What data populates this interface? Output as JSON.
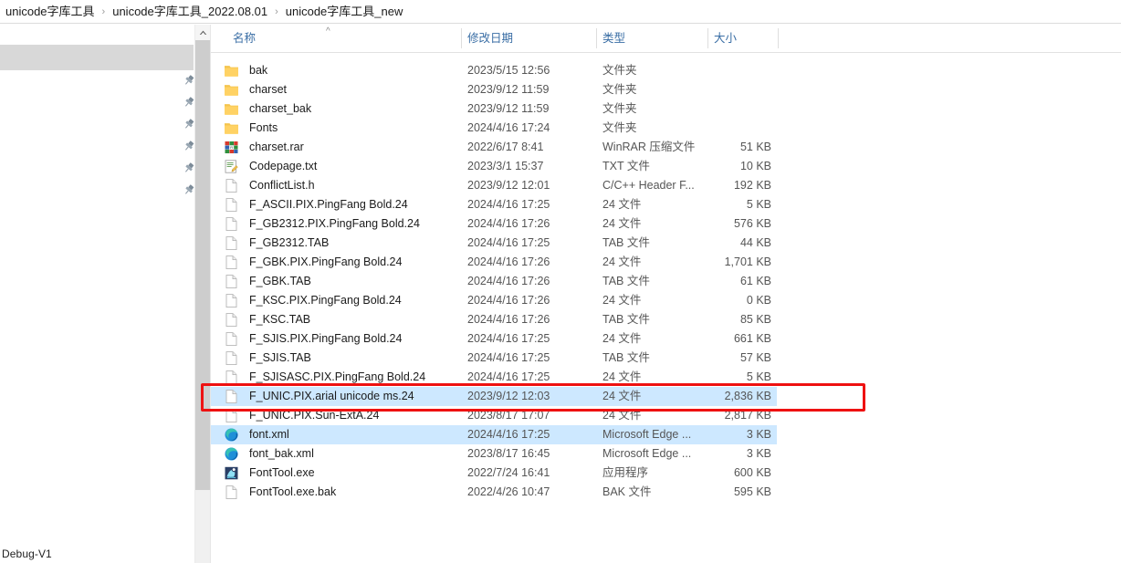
{
  "window": {
    "title": "unicode字库工具_new"
  },
  "breadcrumb": {
    "separator": "›",
    "items": [
      {
        "label": "unicode字库工具"
      },
      {
        "label": "unicode字库工具_2022.08.01"
      },
      {
        "label": "unicode字库工具_new"
      }
    ]
  },
  "left_pane": {
    "status_text": "Debug-V1",
    "pin_count": 6,
    "pin_icon": "pin-icon"
  },
  "scrollbar": {
    "up_arrow_icon": "chevron-up-icon",
    "thumb_color": "#cdcdcd",
    "track_color": "#f0f0f0"
  },
  "columns": {
    "headers": [
      {
        "label": "名称",
        "key": "name"
      },
      {
        "label": "修改日期",
        "key": "date"
      },
      {
        "label": "类型",
        "key": "type"
      },
      {
        "label": "大小",
        "key": "size"
      }
    ],
    "sort_indicator": "^",
    "sorted_by": "名称",
    "sort_direction": "ascending"
  },
  "colors": {
    "header_text": "#3a6ea5",
    "selection": "#cde8ff",
    "annotation": "#ee1111",
    "folder": "#ffd264",
    "left_band": "#d8d8d8"
  },
  "files": [
    {
      "name": "bak",
      "date": "2023/5/15 12:56",
      "type": "文件夹",
      "size": "",
      "icon": "folder-icon",
      "selected": false
    },
    {
      "name": "charset",
      "date": "2023/9/12 11:59",
      "type": "文件夹",
      "size": "",
      "icon": "folder-icon",
      "selected": false
    },
    {
      "name": "charset_bak",
      "date": "2023/9/12 11:59",
      "type": "文件夹",
      "size": "",
      "icon": "folder-icon",
      "selected": false
    },
    {
      "name": "Fonts",
      "date": "2024/4/16 17:24",
      "type": "文件夹",
      "size": "",
      "icon": "folder-icon",
      "selected": false
    },
    {
      "name": "charset.rar",
      "date": "2022/6/17 8:41",
      "type": "WinRAR 压缩文件",
      "size": "51 KB",
      "icon": "winrar-icon",
      "selected": false
    },
    {
      "name": "Codepage.txt",
      "date": "2023/3/1 15:37",
      "type": "TXT 文件",
      "size": "10 KB",
      "icon": "notepad-icon",
      "selected": false
    },
    {
      "name": "ConflictList.h",
      "date": "2023/9/12 12:01",
      "type": "C/C++ Header F...",
      "size": "192 KB",
      "icon": "file-icon",
      "selected": false
    },
    {
      "name": "F_ASCII.PIX.PingFang Bold.24",
      "date": "2024/4/16 17:25",
      "type": "24 文件",
      "size": "5 KB",
      "icon": "file-icon",
      "selected": false
    },
    {
      "name": "F_GB2312.PIX.PingFang Bold.24",
      "date": "2024/4/16 17:26",
      "type": "24 文件",
      "size": "576 KB",
      "icon": "file-icon",
      "selected": false
    },
    {
      "name": "F_GB2312.TAB",
      "date": "2024/4/16 17:25",
      "type": "TAB 文件",
      "size": "44 KB",
      "icon": "file-icon",
      "selected": false
    },
    {
      "name": "F_GBK.PIX.PingFang Bold.24",
      "date": "2024/4/16 17:26",
      "type": "24 文件",
      "size": "1,701 KB",
      "icon": "file-icon",
      "selected": false
    },
    {
      "name": "F_GBK.TAB",
      "date": "2024/4/16 17:26",
      "type": "TAB 文件",
      "size": "61 KB",
      "icon": "file-icon",
      "selected": false
    },
    {
      "name": "F_KSC.PIX.PingFang Bold.24",
      "date": "2024/4/16 17:26",
      "type": "24 文件",
      "size": "0 KB",
      "icon": "file-icon",
      "selected": false
    },
    {
      "name": "F_KSC.TAB",
      "date": "2024/4/16 17:26",
      "type": "TAB 文件",
      "size": "85 KB",
      "icon": "file-icon",
      "selected": false
    },
    {
      "name": "F_SJIS.PIX.PingFang Bold.24",
      "date": "2024/4/16 17:25",
      "type": "24 文件",
      "size": "661 KB",
      "icon": "file-icon",
      "selected": false
    },
    {
      "name": "F_SJIS.TAB",
      "date": "2024/4/16 17:25",
      "type": "TAB 文件",
      "size": "57 KB",
      "icon": "file-icon",
      "selected": false
    },
    {
      "name": "F_SJISASC.PIX.PingFang Bold.24",
      "date": "2024/4/16 17:25",
      "type": "24 文件",
      "size": "5 KB",
      "icon": "file-icon",
      "selected": false
    },
    {
      "name": "F_UNIC.PIX.arial unicode ms.24",
      "date": "2023/9/12 12:03",
      "type": "24 文件",
      "size": "2,836 KB",
      "icon": "file-icon",
      "selected": true
    },
    {
      "name": "F_UNIC.PIX.Sun-ExtA.24",
      "date": "2023/8/17 17:07",
      "type": "24 文件",
      "size": "2,817 KB",
      "icon": "file-icon",
      "selected": false
    },
    {
      "name": "font.xml",
      "date": "2024/4/16 17:25",
      "type": "Microsoft Edge ...",
      "size": "3 KB",
      "icon": "edge-icon",
      "selected": true
    },
    {
      "name": "font_bak.xml",
      "date": "2023/8/17 16:45",
      "type": "Microsoft Edge ...",
      "size": "3 KB",
      "icon": "edge-icon",
      "selected": false
    },
    {
      "name": "FontTool.exe",
      "date": "2022/7/24 16:41",
      "type": "应用程序",
      "size": "600 KB",
      "icon": "exe-icon",
      "selected": false
    },
    {
      "name": "FontTool.exe.bak",
      "date": "2022/4/26 10:47",
      "type": "BAK 文件",
      "size": "595 KB",
      "icon": "file-icon",
      "selected": false
    }
  ],
  "annotation": {
    "type": "rectangle",
    "target_row_name": "F_UNIC.PIX.arial unicode ms.24",
    "color": "#ee1111"
  }
}
